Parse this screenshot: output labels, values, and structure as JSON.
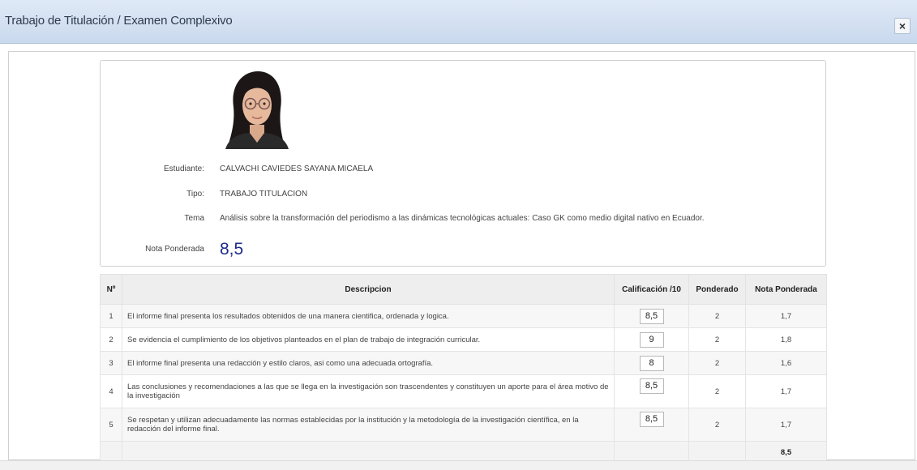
{
  "dialog": {
    "title": "Trabajo de Titulación / Examen Complexivo",
    "close_label": "×"
  },
  "student": {
    "labels": {
      "estudiante": "Estudiante:",
      "tipo": "Tipo:",
      "tema": "Tema",
      "nota": "Nota Ponderada"
    },
    "name": "CALVACHI CAVIEDES SAYANA MICAELA",
    "tipo": "TRABAJO TITULACION",
    "tema": "Análisis sobre la transformación del periodismo a las dinámicas tecnológicas actuales: Caso GK como medio digital nativo en Ecuador.",
    "nota": "8,5"
  },
  "table": {
    "headers": [
      "Nº",
      "Descripcion",
      "Calificación /10",
      "Ponderado",
      "Nota Ponderada"
    ],
    "rows": [
      {
        "n": "1",
        "desc": "El informe final presenta los resultados obtenidos de una manera cientifica, ordenada y logica.",
        "grade": "8,5",
        "weight": "2",
        "weighted": "1,7"
      },
      {
        "n": "2",
        "desc": "Se evidencia el cumplimiento de los objetivos planteados en el plan de trabajo de integración curricular.",
        "grade": "9",
        "weight": "2",
        "weighted": "1,8"
      },
      {
        "n": "3",
        "desc": "El informe final presenta una redacción y estilo claros, asi como una adecuada ortografía.",
        "grade": "8",
        "weight": "2",
        "weighted": "1,6"
      },
      {
        "n": "4",
        "desc": "Las conclusiones y recomendaciones a las que se llega en la investigación son trascendentes y constituyen un aporte para el área motivo de la investigación",
        "grade": "8,5",
        "weight": "2",
        "weighted": "1,7"
      },
      {
        "n": "5",
        "desc": "Se respetan y utilizan adecuadamente las normas establecidas por la institución y la metodología de la investigación científica, en la redacción del informe final.",
        "grade": "8,5",
        "weight": "2",
        "weighted": "1,7"
      }
    ],
    "total": "8,5"
  },
  "colors": {
    "header_bg": "#c9d9ee",
    "grade_accent": "#1e2a8c"
  }
}
